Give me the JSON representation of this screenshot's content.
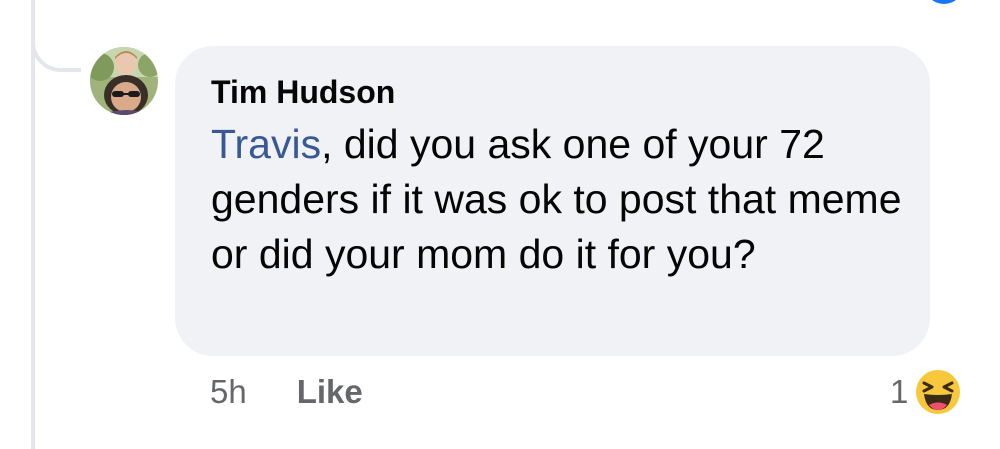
{
  "comment": {
    "author": "Tim Hudson",
    "mention": "Travis",
    "text": ", did you ask one of your 72 genders if it was ok to post that meme or did your mom do it for you?",
    "time": "5h",
    "like_label": "Like",
    "reaction_count": "1",
    "reaction_icon": "haha-emoji-icon"
  },
  "colors": {
    "bubble": "#f0f2f5",
    "mention": "#385898",
    "meta_text": "#65676b",
    "badge": "#1877f2"
  }
}
